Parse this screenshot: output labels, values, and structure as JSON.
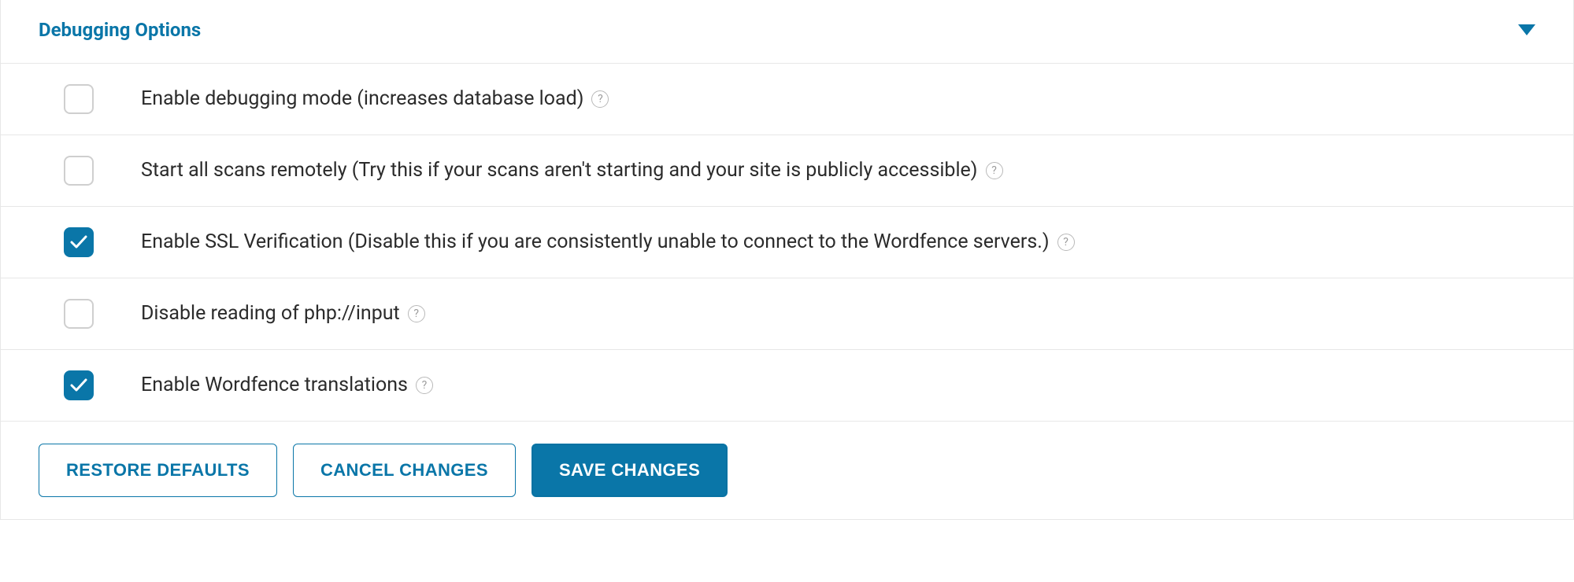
{
  "section": {
    "title": "Debugging Options"
  },
  "options": [
    {
      "label": "Enable debugging mode (increases database load)",
      "checked": false
    },
    {
      "label": "Start all scans remotely (Try this if your scans aren't starting and your site is publicly accessible)",
      "checked": false
    },
    {
      "label": "Enable SSL Verification (Disable this if you are consistently unable to connect to the Wordfence servers.)",
      "checked": true
    },
    {
      "label": "Disable reading of php://input",
      "checked": false
    },
    {
      "label": "Enable Wordfence translations",
      "checked": true
    }
  ],
  "buttons": {
    "restore": "RESTORE DEFAULTS",
    "cancel": "CANCEL CHANGES",
    "save": "SAVE CHANGES"
  },
  "help_glyph": "?"
}
